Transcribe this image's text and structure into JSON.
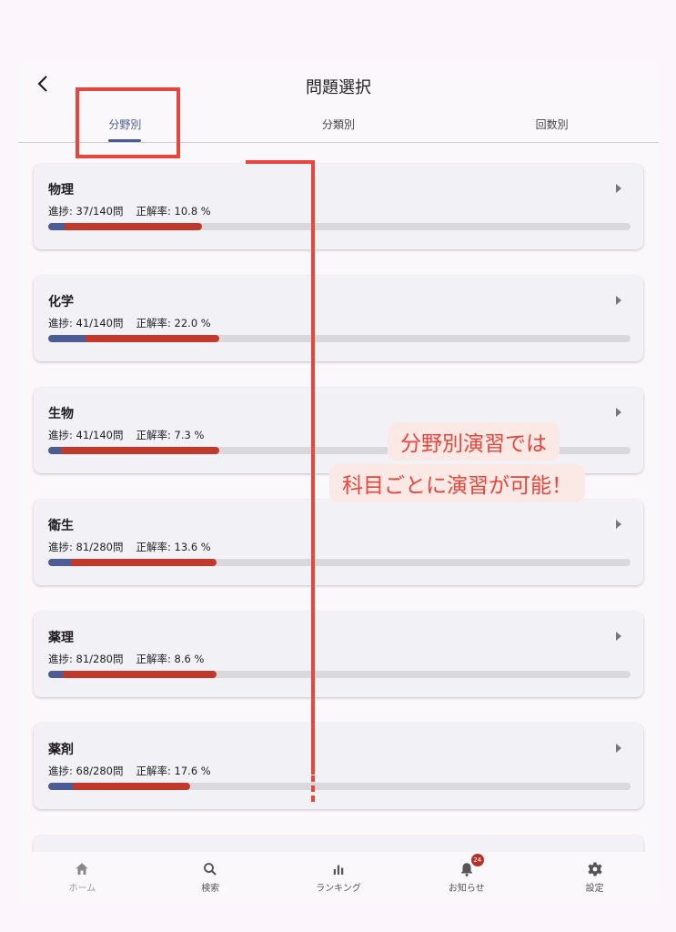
{
  "header": {
    "title": "問題選択",
    "back_icon": "chevron-left-icon"
  },
  "tabs": [
    {
      "label": "分野別",
      "active": true
    },
    {
      "label": "分類別",
      "active": false
    },
    {
      "label": "回数別",
      "active": false
    }
  ],
  "subjects": [
    {
      "name": "物理",
      "progress_label": "進捗: 37/140問",
      "accuracy_label": "正解率: 10.8 %",
      "progress": 0.264,
      "accuracy": 0.108
    },
    {
      "name": "化学",
      "progress_label": "進捗: 41/140問",
      "accuracy_label": "正解率: 22.0 %",
      "progress": 0.293,
      "accuracy": 0.22
    },
    {
      "name": "生物",
      "progress_label": "進捗: 41/140問",
      "accuracy_label": "正解率: 7.3 %",
      "progress": 0.293,
      "accuracy": 0.073
    },
    {
      "name": "衛生",
      "progress_label": "進捗: 81/280問",
      "accuracy_label": "正解率: 13.6 %",
      "progress": 0.289,
      "accuracy": 0.136
    },
    {
      "name": "薬理",
      "progress_label": "進捗: 81/280問",
      "accuracy_label": "正解率: 8.6 %",
      "progress": 0.289,
      "accuracy": 0.086
    },
    {
      "name": "薬剤",
      "progress_label": "進捗: 68/280問",
      "accuracy_label": "正解率: 17.6 %",
      "progress": 0.243,
      "accuracy": 0.176
    }
  ],
  "nav": [
    {
      "label": "ホーム",
      "icon": "home-icon"
    },
    {
      "label": "検索",
      "icon": "search-icon"
    },
    {
      "label": "ランキング",
      "icon": "bar-chart-icon"
    },
    {
      "label": "お知らせ",
      "icon": "bell-icon",
      "badge": "24"
    },
    {
      "label": "設定",
      "icon": "gear-icon"
    }
  ],
  "annotation": {
    "line1": "分野別演習では",
    "line2": "科目ごとに演習が可能！"
  },
  "colors": {
    "accent": "#4a5a96",
    "progress": "#c0392b",
    "correct": "#4c5c94",
    "annotation": "#e8453c"
  }
}
